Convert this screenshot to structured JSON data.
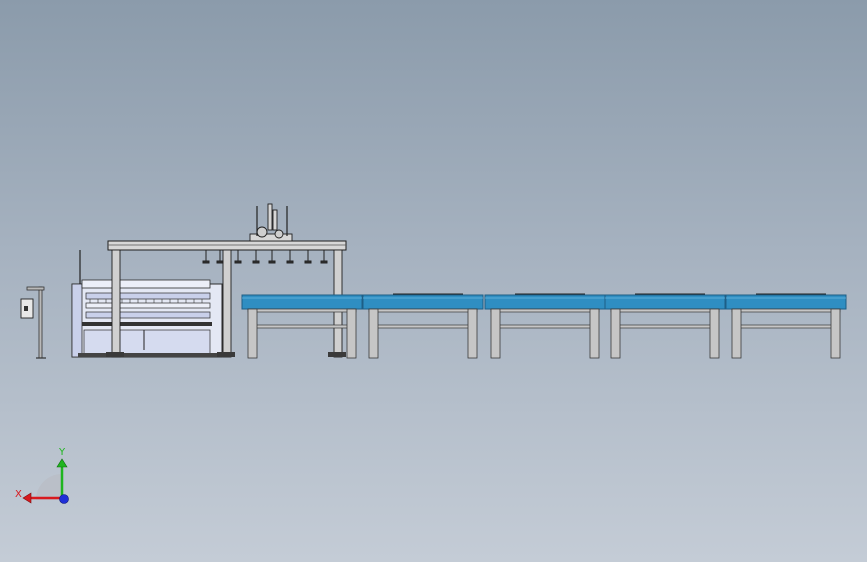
{
  "viewport": {
    "background_top": "#8b9bab",
    "background_bottom": "#c4ccd6"
  },
  "colors": {
    "conveyor": "#2f8ec2",
    "conveyor_edge": "#1d5e86",
    "frame": "#c6c6c6",
    "frame_dark": "#3a3a3a",
    "machine_body": "#e4e8f4",
    "machine_panel": "#c9d0ea"
  },
  "triad": {
    "x_label": "X",
    "y_label": "Y",
    "x_color": "#d8191e",
    "y_color": "#1fb51f",
    "z_color": "#1f2fd8"
  },
  "icons": [
    "coordinate-triad-icon"
  ]
}
